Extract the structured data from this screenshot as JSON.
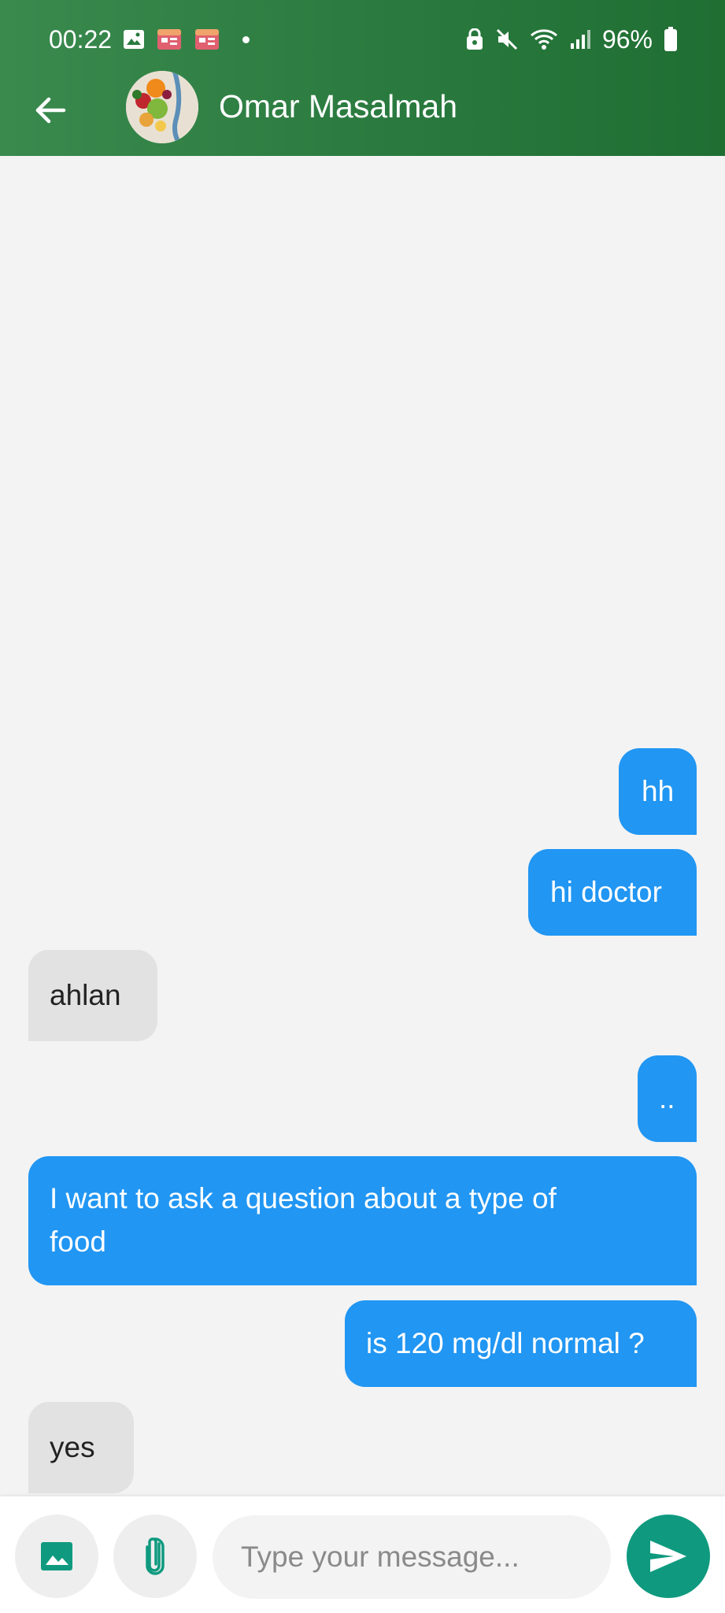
{
  "status_bar": {
    "time": "00:22",
    "battery": "96%",
    "left_icons": [
      "gallery-icon",
      "calendar-app-icon",
      "calendar-app-icon",
      "notification-dot"
    ],
    "right_icons": [
      "lock-icon",
      "mute-icon",
      "wifi-icon",
      "signal-icon",
      "battery-icon"
    ]
  },
  "header": {
    "contact_name": "Omar Masalmah",
    "back_icon": "arrow-left-icon",
    "color": "#2a7a3f"
  },
  "messages": [
    {
      "text": "hh",
      "direction": "sent"
    },
    {
      "text": "hi doctor",
      "direction": "sent"
    },
    {
      "text": "ahlan",
      "direction": "received"
    },
    {
      "text": "..",
      "direction": "sent"
    },
    {
      "text": "I want to ask a question about a type of\nfood",
      "direction": "sent"
    },
    {
      "text": "is 120 mg/dl normal ?",
      "direction": "sent"
    },
    {
      "text": "yes",
      "direction": "received"
    }
  ],
  "input_bar": {
    "placeholder": "Type your message...",
    "image_button_icon": "image-icon",
    "attach_button_icon": "paperclip-icon",
    "send_button_icon": "send-icon"
  },
  "colors": {
    "sent_bubble": "#2196f3",
    "received_bubble": "#e2e2e2",
    "send_button": "#0f9a7f",
    "background": "#f3f3f3"
  }
}
